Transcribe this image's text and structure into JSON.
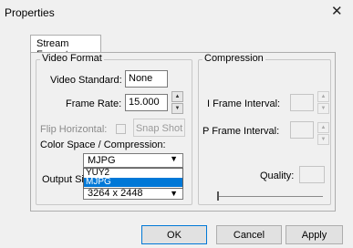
{
  "window": {
    "title": "Properties",
    "close_glyph": "✕"
  },
  "tabs": [
    {
      "label": "Stream Format"
    }
  ],
  "video_format": {
    "legend": "Video Format",
    "video_standard": {
      "label": "Video Standard:",
      "value": "None"
    },
    "frame_rate": {
      "label": "Frame Rate:",
      "value": "15.000"
    },
    "flip_horizontal": {
      "label": "Flip Horizontal:",
      "checked": false
    },
    "snap_shot_label": "Snap Shot",
    "color_space": {
      "label": "Color Space / Compression:",
      "selected": "MJPG",
      "options": [
        "YUY2",
        "MJPG"
      ]
    },
    "output_size": {
      "label": "Output Si",
      "value": "3264 x 2448"
    }
  },
  "compression": {
    "legend": "Compression",
    "i_frame_interval": {
      "label": "I Frame Interval:",
      "value": ""
    },
    "p_frame_interval": {
      "label": "P Frame Interval:",
      "value": ""
    },
    "quality": {
      "label": "Quality:",
      "value": ""
    }
  },
  "buttons": {
    "ok": "OK",
    "cancel": "Cancel",
    "apply": "Apply"
  },
  "colors": {
    "selection": "#0078d7",
    "window_bg": "#f0f0f0"
  },
  "icons": {
    "spin_up": "▲",
    "spin_down": "▼",
    "dropdown_arrow": "▼"
  }
}
